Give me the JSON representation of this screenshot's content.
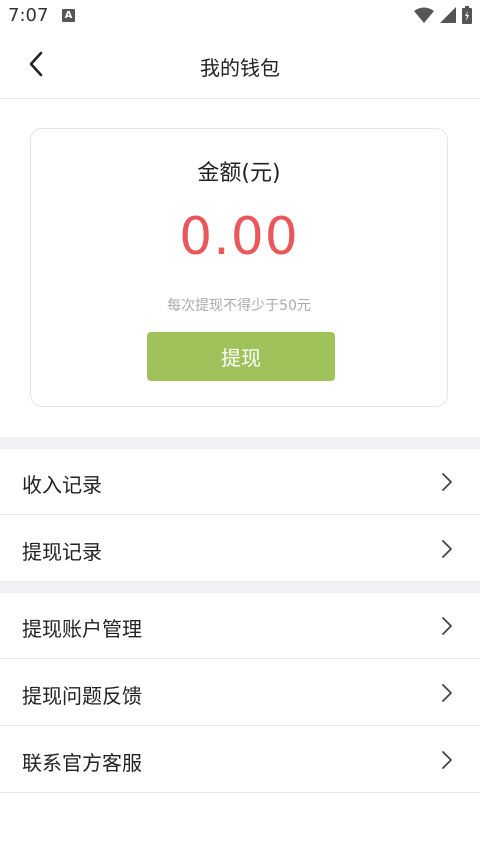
{
  "status": {
    "time": "7:07",
    "notification_letter": "A"
  },
  "appbar": {
    "title": "我的钱包"
  },
  "wallet": {
    "amount_label": "金额(元)",
    "amount_value": "0.00",
    "min_tip": "每次提现不得少于50元",
    "withdraw_label": "提现"
  },
  "list_group_1": [
    {
      "label": "收入记录"
    },
    {
      "label": "提现记录"
    }
  ],
  "list_group_2": [
    {
      "label": "提现账户管理"
    },
    {
      "label": "提现问题反馈"
    },
    {
      "label": "联系官方客服"
    }
  ],
  "colors": {
    "accent_green": "#9fc35a",
    "amount_red": "#e8585b",
    "divider": "#e6e6e6",
    "section_gap": "#f2f2f4"
  }
}
